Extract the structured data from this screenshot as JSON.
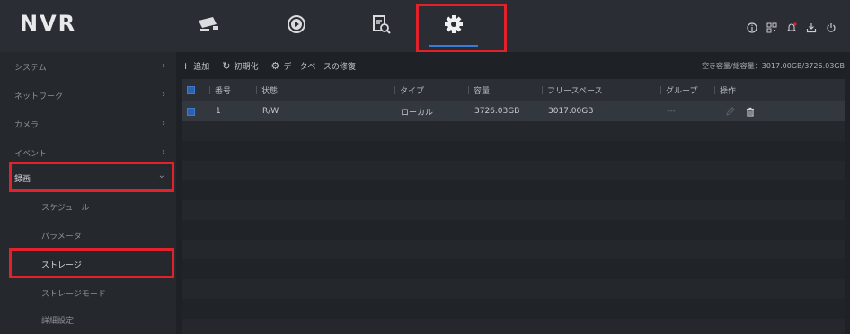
{
  "app": {
    "logo": "NVR"
  },
  "topnav": [
    {
      "name": "camera-icon"
    },
    {
      "name": "playback-icon"
    },
    {
      "name": "search-file-icon"
    },
    {
      "name": "settings-gear-icon",
      "active": true
    }
  ],
  "system_icons": [
    "info-icon",
    "qr-code-icon",
    "notification-bell-icon",
    "download-icon",
    "power-icon"
  ],
  "sidebar": {
    "items": [
      {
        "label": "システム",
        "level": "top",
        "chevron": "›"
      },
      {
        "label": "ネットワーク",
        "level": "top",
        "chevron": "›"
      },
      {
        "label": "カメラ",
        "level": "top",
        "chevron": "›"
      },
      {
        "label": "イベント",
        "level": "top",
        "chevron": "›"
      },
      {
        "label": "録画",
        "level": "top",
        "chevron": "⌄",
        "expanded": true
      },
      {
        "label": "スケジュール",
        "level": "sub"
      },
      {
        "label": "パラメータ",
        "level": "sub"
      },
      {
        "label": "ストレージ",
        "level": "sub",
        "selected": true
      },
      {
        "label": "ストレージモード",
        "level": "sub"
      },
      {
        "label": "詳細設定",
        "level": "sub"
      }
    ]
  },
  "toolbar": {
    "add": "追加",
    "init": "初期化",
    "repair": "データベースの修復",
    "capacity": "空き容量/総容量：3017.00GB/3726.03GB"
  },
  "table": {
    "headers": {
      "no": "番号",
      "status": "状態",
      "type": "タイプ",
      "capacity": "容量",
      "free": "フリースペース",
      "group": "グループ",
      "ops": "操作"
    },
    "rows": [
      {
        "no": "1",
        "status": "R/W",
        "type": "ローカル",
        "capacity": "3726.03GB",
        "free": "3017.00GB",
        "group": "---"
      }
    ]
  },
  "colors": {
    "accent": "#3a7bd5",
    "highlight": "#e3212b",
    "background": "#1c1f24"
  }
}
